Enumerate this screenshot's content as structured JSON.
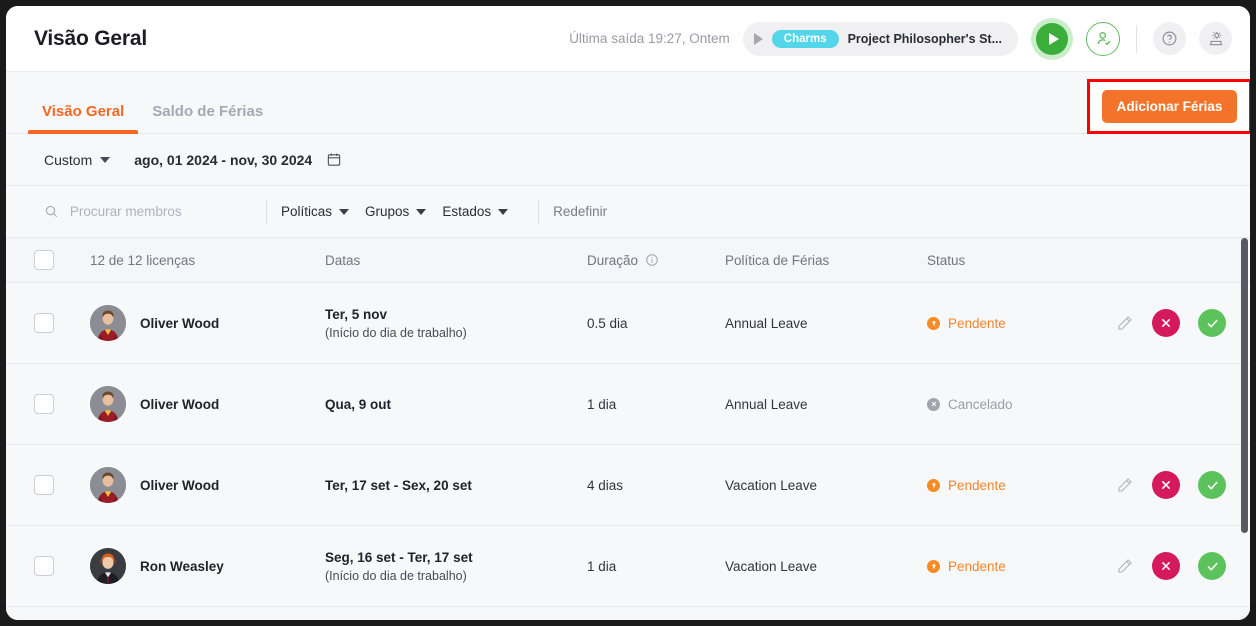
{
  "header": {
    "title": "Visão Geral",
    "last_out": "Última saída 19:27, Ontem",
    "task": {
      "badge": "Charms",
      "name": "Project Philosopher's St..."
    },
    "icons": {
      "play": "play-icon",
      "user_check": "user-check-icon",
      "help": "help-circle-icon",
      "settings": "settings-icon"
    }
  },
  "tabs": {
    "items": [
      {
        "label": "Visão Geral",
        "active": true
      },
      {
        "label": "Saldo de Férias",
        "active": false
      }
    ],
    "add_button": "Adicionar Férias"
  },
  "date_bar": {
    "preset": "Custom",
    "range": "ago, 01 2024 - nov, 30 2024",
    "calendar_icon": "calendar-icon"
  },
  "filters": {
    "search_placeholder": "Procurar membros",
    "search_value": "",
    "dropdowns": [
      "Políticas",
      "Grupos",
      "Estados"
    ],
    "reset": "Redefinir"
  },
  "table": {
    "headers": {
      "licenses": "12 de 12 licenças",
      "dates": "Datas",
      "duration": "Duração",
      "policy": "Política de Férias",
      "status": "Status"
    },
    "rows": [
      {
        "name": "Oliver Wood",
        "avatar": "oliver-wood-avatar",
        "dates_main": "Ter, 5 nov",
        "dates_sub": "(Início do dia de trabalho)",
        "duration": "0.5 dia",
        "policy": "Annual Leave",
        "status": "Pendente",
        "status_type": "pendente",
        "has_actions": true
      },
      {
        "name": "Oliver Wood",
        "avatar": "oliver-wood-avatar",
        "dates_main": "Qua, 9 out",
        "dates_sub": "",
        "duration": "1 dia",
        "policy": "Annual Leave",
        "status": "Cancelado",
        "status_type": "cancelado",
        "has_actions": false
      },
      {
        "name": "Oliver Wood",
        "avatar": "oliver-wood-avatar",
        "dates_main": "Ter, 17 set - Sex, 20 set",
        "dates_sub": "",
        "duration": "4 dias",
        "policy": "Vacation Leave",
        "status": "Pendente",
        "status_type": "pendente",
        "has_actions": true
      },
      {
        "name": "Ron Weasley",
        "avatar": "ron-weasley-avatar",
        "dates_main": "Seg, 16 set - Ter, 17 set",
        "dates_sub": "(Início do dia de trabalho)",
        "duration": "1 dia",
        "policy": "Vacation Leave",
        "status": "Pendente",
        "status_type": "pendente",
        "has_actions": true
      }
    ],
    "action_icons": {
      "edit": "pencil-icon",
      "reject": "x-circle-icon",
      "approve": "check-circle-icon"
    }
  },
  "colors": {
    "accent": "#f26722",
    "add_button": "#f4732a",
    "highlight_border": "#ff0000",
    "charm_badge": "#54d6ea",
    "pending": "#f4852a",
    "cancelled": "#9b9da6",
    "reject": "#d41a5c",
    "approve": "#5cc35c",
    "play_green": "#3aad3a"
  }
}
